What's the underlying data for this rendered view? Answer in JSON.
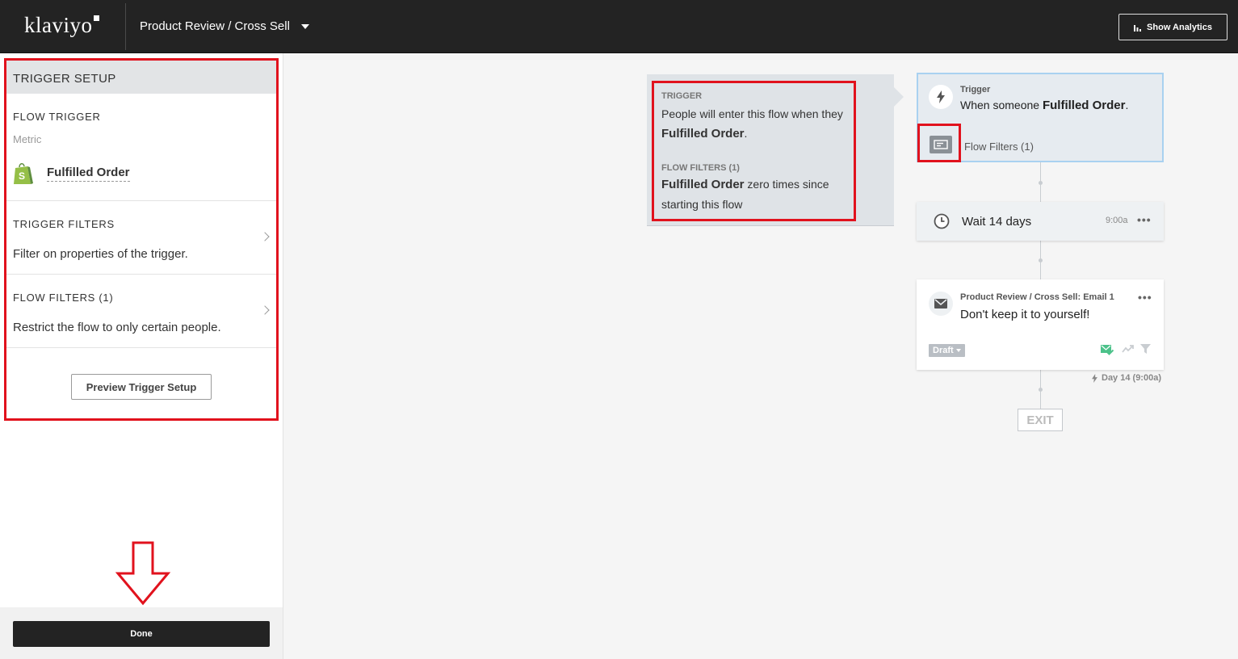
{
  "header": {
    "logo": "klaviyo",
    "flow_name": "Product Review / Cross Sell",
    "analytics_label": "Show Analytics"
  },
  "sidebar": {
    "panel_title": "TRIGGER SETUP",
    "flow_trigger": {
      "title": "FLOW TRIGGER",
      "sub": "Metric",
      "metric": "Fulfilled Order",
      "metric_icon": "shopify-bag-icon"
    },
    "trigger_filters": {
      "title": "TRIGGER FILTERS",
      "desc": "Filter on properties of the trigger."
    },
    "flow_filters": {
      "title": "FLOW FILTERS (1)",
      "desc": "Restrict the flow to only certain people."
    },
    "preview_label": "Preview Trigger Setup",
    "done_label": "Done"
  },
  "tooltip": {
    "trigger_label": "TRIGGER",
    "trigger_text_pre": "People will enter this flow when they",
    "trigger_text_bold": "Fulfilled Order",
    "trigger_text_post": ".",
    "filters_label": "FLOW FILTERS (1)",
    "filters_bold": "Fulfilled Order",
    "filters_text": " zero times since starting this flow"
  },
  "canvas": {
    "trigger_card": {
      "label": "Trigger",
      "text_pre": "When someone ",
      "text_bold": "Fulfilled Order",
      "text_post": ".",
      "filters_label": "Flow Filters (1)"
    },
    "wait_card": {
      "label": "Wait 14 days",
      "time": "9:00a",
      "menu": "•••"
    },
    "email_card": {
      "label": "Product Review / Cross Sell: Email 1",
      "subject": "Don't keep it to yourself!",
      "status": "Draft",
      "menu": "•••"
    },
    "day_label": "Day 14 (9:00a)",
    "exit_label": "EXIT"
  },
  "colors": {
    "topbar": "#232323",
    "highlight_red": "#e1121d",
    "trigger_card_border": "#a9d1f0",
    "shopify_green": "#95bf47",
    "email_ok_green": "#4cc28a"
  }
}
